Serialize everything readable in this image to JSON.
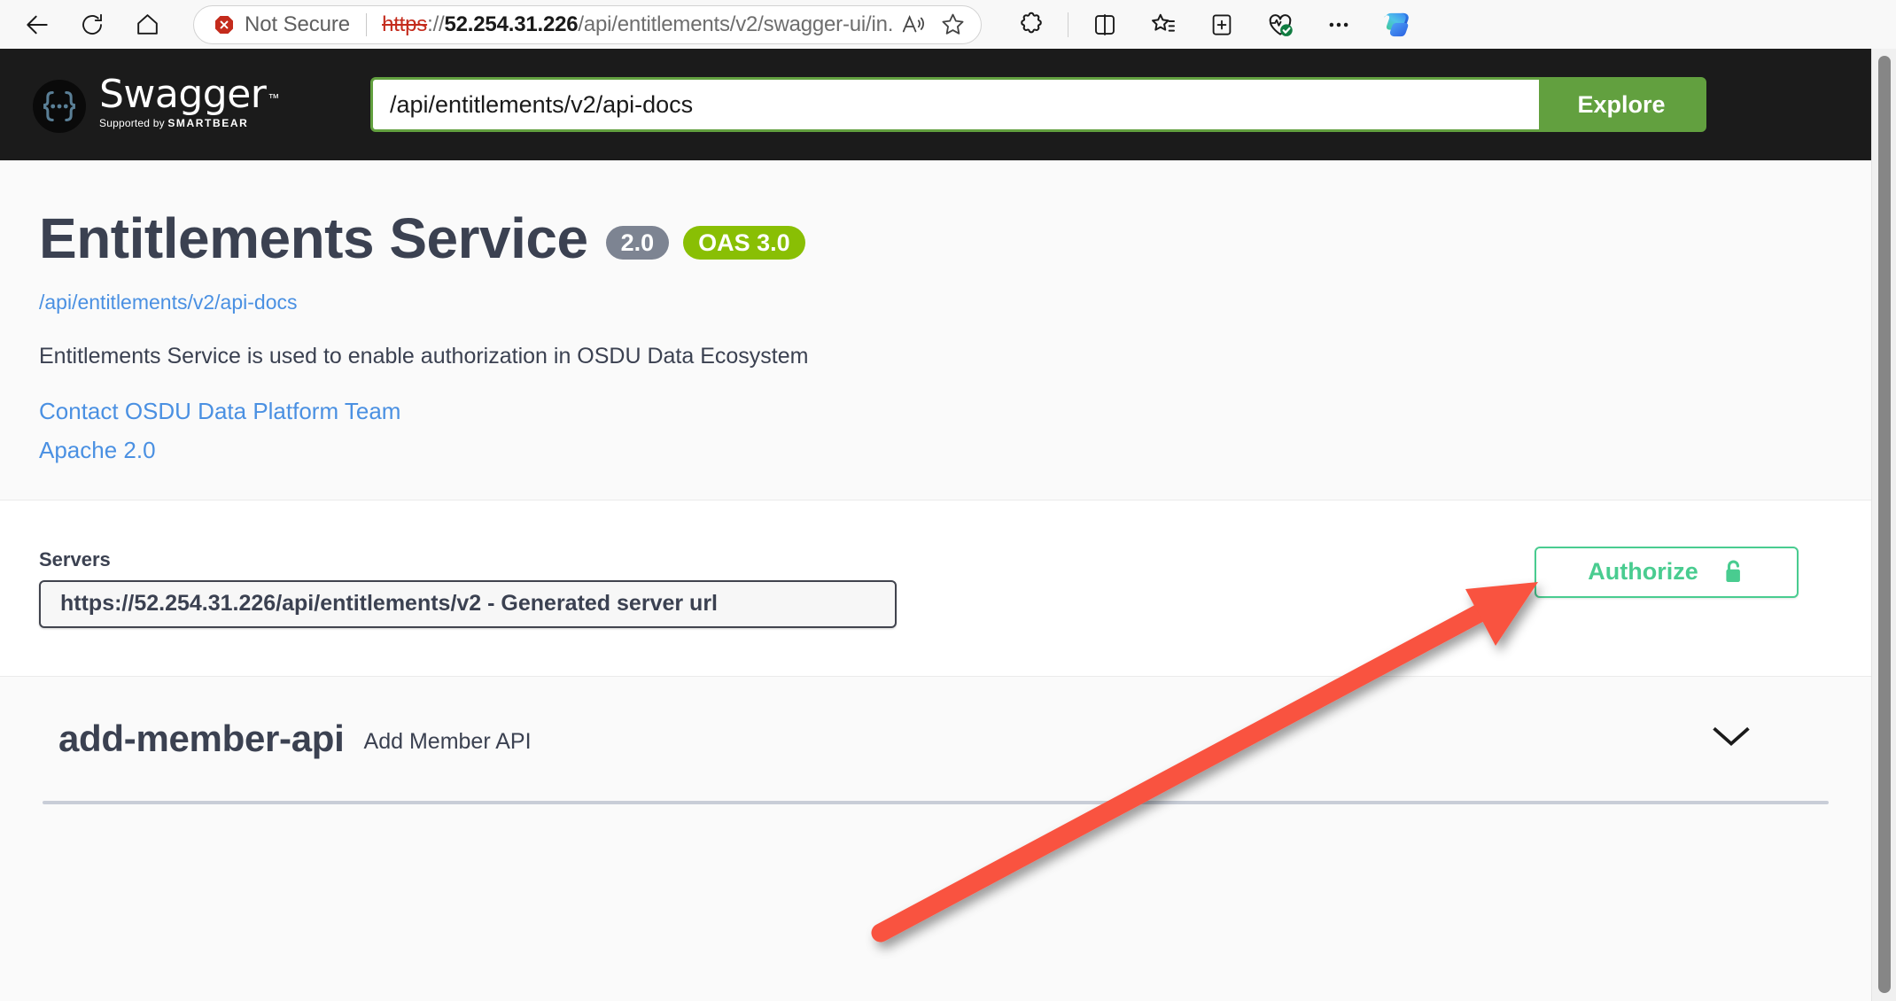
{
  "browser": {
    "nav": {
      "back_icon": "arrow-left-icon",
      "refresh_icon": "refresh-icon",
      "home_icon": "home-icon"
    },
    "address_bar": {
      "security_label": "Not Secure",
      "security_icon": "not-secure-icon",
      "url_scheme": "https",
      "url_separator": "://",
      "url_host": "52.254.31.226",
      "url_path": "/api/entitlements/v2/swagger-ui/in...",
      "read_aloud_icon": "read-aloud-icon",
      "favorite_icon": "star-outline-icon"
    },
    "toolbar": [
      {
        "name": "extensions-icon",
        "label": "Extensions"
      },
      {
        "name": "split-screen-icon",
        "label": "Split screen"
      },
      {
        "name": "favorites-icon",
        "label": "Favorites"
      },
      {
        "name": "collections-icon",
        "label": "Collections"
      },
      {
        "name": "browser-essentials-icon",
        "label": "Browser essentials"
      },
      {
        "name": "more-options-icon",
        "label": "Settings and more"
      },
      {
        "name": "copilot-icon",
        "label": "Copilot"
      }
    ]
  },
  "topbar": {
    "logo_text": "Swagger",
    "logo_tm": "™",
    "logo_sub_prefix": "Supported by ",
    "logo_sub_brand": "SMARTBEAR",
    "explore_value": "/api/entitlements/v2/api-docs",
    "explore_placeholder": "/api/entitlements/v2/api-docs",
    "explore_button": "Explore"
  },
  "info": {
    "title": "Entitlements Service",
    "version_badge": "2.0",
    "oas_badge": "OAS 3.0",
    "docs_url": "/api/entitlements/v2/api-docs",
    "description": "Entitlements Service is used to enable authorization in OSDU Data Ecosystem",
    "contact_link": "Contact OSDU Data Platform Team",
    "license_link": "Apache 2.0"
  },
  "servers": {
    "label": "Servers",
    "selected": "https://52.254.31.226/api/entitlements/v2 - Generated server url",
    "options": [
      "https://52.254.31.226/api/entitlements/v2 - Generated server url"
    ],
    "authorize_label": "Authorize",
    "authorize_icon": "unlock-icon"
  },
  "tags": [
    {
      "name": "add-member-api",
      "description": "Add Member API",
      "expand_icon": "chevron-down-icon"
    }
  ],
  "annotation": {
    "arrow_color": "#f9523f",
    "points_to": "Authorize"
  },
  "colors": {
    "swagger_dark": "#1b1b1b",
    "explore_green": "#62a03f",
    "oas_green": "#89bf04",
    "version_gray": "#7d8492",
    "authorize_green": "#49cc90",
    "link_blue": "#4a90e2",
    "text_dark": "#3b4151"
  }
}
